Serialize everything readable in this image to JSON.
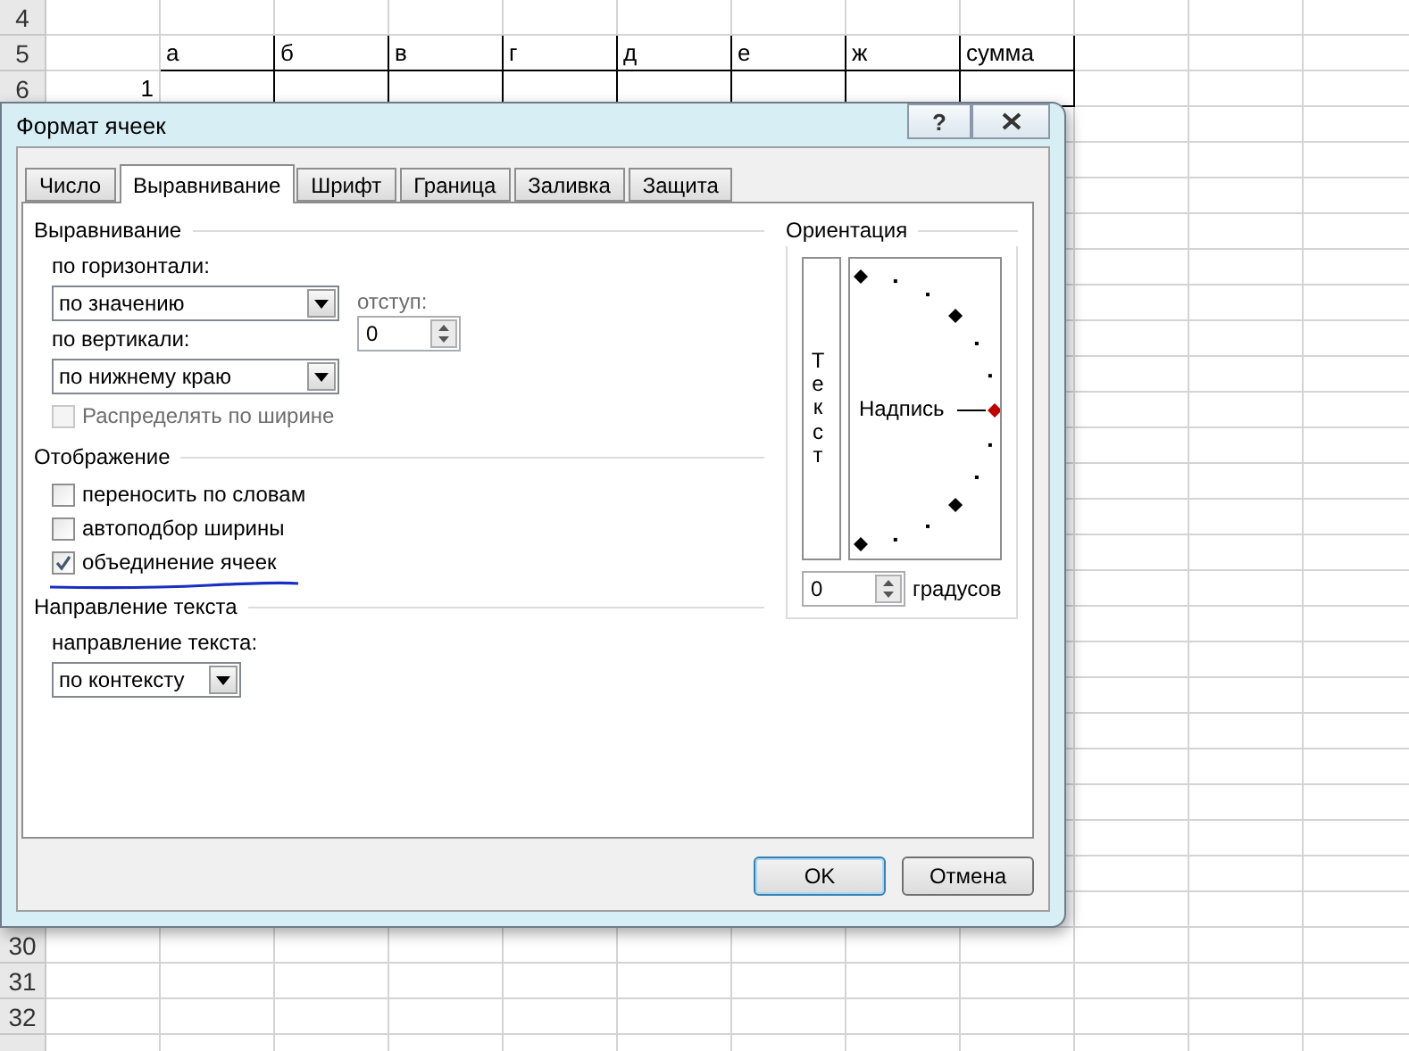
{
  "sheet": {
    "rows": [
      {
        "label": "4",
        "kind": "plain"
      },
      {
        "label": "5",
        "kind": "table-header",
        "cells": [
          "а",
          "б",
          "в",
          "г",
          "д",
          "е",
          "ж",
          "сумма"
        ]
      },
      {
        "label": "6",
        "kind": "table-row",
        "cells": [
          "1"
        ]
      },
      {
        "label": "30",
        "kind": "plain"
      },
      {
        "label": "31",
        "kind": "plain"
      },
      {
        "label": "32",
        "kind": "plain"
      }
    ]
  },
  "dialog": {
    "title": "Формат ячеек",
    "help": "?",
    "tabs": [
      {
        "label": "Число",
        "selected": false
      },
      {
        "label": "Выравнивание",
        "selected": true
      },
      {
        "label": "Шрифт",
        "selected": false
      },
      {
        "label": "Граница",
        "selected": false
      },
      {
        "label": "Заливка",
        "selected": false
      },
      {
        "label": "Защита",
        "selected": false
      }
    ],
    "alignment": {
      "title": "Выравнивание",
      "horizontal_label": "по горизонтали:",
      "horizontal_value": "по значению",
      "indent_label": "отступ:",
      "indent_value": "0",
      "vertical_label": "по вертикали:",
      "vertical_value": "по нижнему краю",
      "distribute": {
        "label": "Распределять по ширине",
        "checked": false,
        "disabled": true
      }
    },
    "display": {
      "title": "Отображение",
      "options": [
        {
          "label": "переносить по словам",
          "checked": false
        },
        {
          "label": "автоподбор ширины",
          "checked": false
        },
        {
          "label": "объединение ячеек",
          "checked": true
        }
      ]
    },
    "direction": {
      "title": "Направление текста",
      "label": "направление текста:",
      "value": "по контексту"
    },
    "orientation": {
      "title": "Ориентация",
      "vertical_text": "Текст",
      "caption": "Надпись",
      "degrees_value": "0",
      "degrees_label": "градусов"
    },
    "buttons": [
      {
        "label": "OK",
        "default": true
      },
      {
        "label": "Отмена",
        "default": false
      }
    ]
  }
}
